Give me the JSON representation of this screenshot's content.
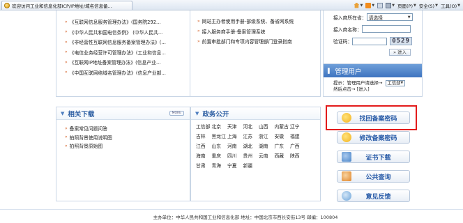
{
  "browser": {
    "tab_title": "欢迎访问工业和信息化部ICP/IP地址/域名信息备...",
    "page_menu": "页面(P)",
    "safety_menu": "安全(S)",
    "tools_menu": "工具(O)"
  },
  "notices_left": [
    "《互联网信息服务管理办法》(国务院292...",
    "《中华人民共和国电信条例》 (中华人民共...",
    "《非经营性互联网信息服务备案管理办法》(...",
    "《电信业务经营许可管理办法》(工业和信息...",
    "《互联网IP地址备案管理办法》(信息产业...",
    "《中国互联网络域名管理办法》(信息产业部..."
  ],
  "notices_right": [
    "网站主办者使用手册-部级系统、备省网系统",
    "接入服务商手册-备案管理系统",
    "前置审批部门和专项内容管理部门登录指南"
  ],
  "downloads": {
    "title": "相关下载",
    "more": "MORE",
    "items": [
      "备案常见问题问答",
      "拍照背景使用说明图",
      "拍照背景原始图"
    ]
  },
  "gov": {
    "title": "政务公开",
    "regions": [
      "工信部",
      "北京",
      "天津",
      "河北",
      "山西",
      "内蒙古",
      "辽宁",
      "吉林",
      "黑龙江",
      "上海",
      "江苏",
      "浙江",
      "安徽",
      "福建",
      "江西",
      "山东",
      "河南",
      "湖北",
      "湖南",
      "广东",
      "广西",
      "海南",
      "重庆",
      "四川",
      "贵州",
      "云南",
      "西藏",
      "陕西",
      "甘肃",
      "青海",
      "宁夏",
      "新疆"
    ]
  },
  "login": {
    "region_label": "接入商所在省：",
    "region_value": "请选择",
    "name_label": "接入商名称：",
    "name_value": "",
    "captcha_label": "验证码：",
    "captcha_value": "",
    "captcha_image": "0529",
    "submit": "进入"
  },
  "admin": {
    "title": "管理用户",
    "prompt": "提示：管理用户请选择→",
    "select_value": "工信部",
    "prompt2": "然后点击→",
    "enter_link": "[进入]"
  },
  "buttons": [
    {
      "label": "找回备案密码",
      "color": "#f3b21c"
    },
    {
      "label": "修改备案密码",
      "color": "#f3b21c"
    },
    {
      "label": "证书下载",
      "color": "#4b86c9"
    },
    {
      "label": "公共查询",
      "color": "#e0862a"
    },
    {
      "label": "意见反馈",
      "color": "#6aa3d8"
    }
  ],
  "footer": {
    "text": "主办单位：中华人民共和国工业和信息化部  地址：中国北京市西长安街13号  邮编：100804"
  }
}
